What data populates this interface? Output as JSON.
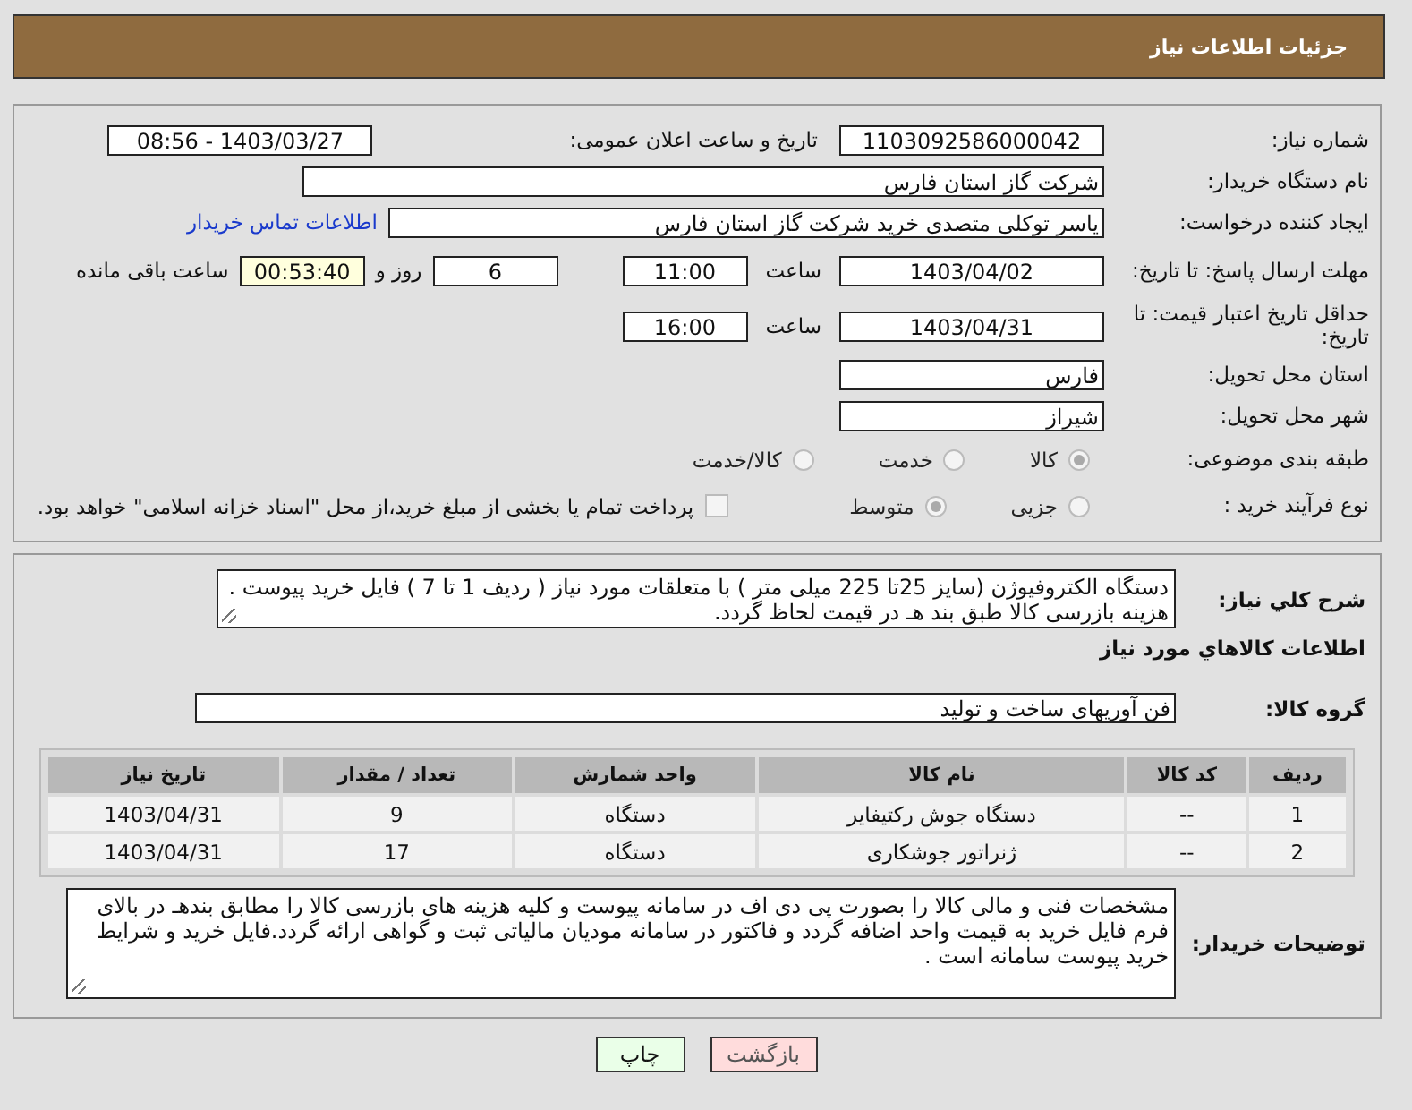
{
  "header": {
    "title": "جزئیات اطلاعات نیاز"
  },
  "details": {
    "need_number": {
      "label": "شماره نیاز:",
      "value": "1103092586000042"
    },
    "announce": {
      "label": "تاریخ و ساعت اعلان عمومی:",
      "value": "1403/03/27 - 08:56"
    },
    "buyer": {
      "label": "نام دستگاه خریدار:",
      "value": "شرکت گاز استان فارس"
    },
    "creator": {
      "label": "ایجاد کننده درخواست:",
      "value": "یاسر توکلی متصدی خرید شرکت گاز استان فارس",
      "link": "اطلاعات تماس خریدار"
    },
    "deadline": {
      "label": "مهلت ارسال پاسخ: تا تاریخ:",
      "date": "1403/04/02",
      "time_label": "ساعت",
      "time": "11:00",
      "days": "6",
      "days_label": "روز و",
      "remaining": "00:53:40",
      "remaining_label": "ساعت باقی مانده"
    },
    "validity": {
      "label": "حداقل تاریخ اعتبار قیمت: تا تاریخ:",
      "date": "1403/04/31",
      "time_label": "ساعت",
      "time": "16:00"
    },
    "province": {
      "label": "استان محل تحویل:",
      "value": "فارس"
    },
    "city": {
      "label": "شهر محل تحویل:",
      "value": "شیراز"
    },
    "category": {
      "label": "طبقه بندی موضوعی:",
      "options": [
        {
          "label": "کالا",
          "selected": true
        },
        {
          "label": "خدمت",
          "selected": false
        },
        {
          "label": "کالا/خدمت",
          "selected": false
        }
      ]
    },
    "process": {
      "label": "نوع فرآیند خرید :",
      "options": [
        {
          "label": "جزیی",
          "selected": false
        },
        {
          "label": "متوسط",
          "selected": true
        }
      ],
      "payment": {
        "checked": false,
        "text": "پرداخت تمام یا بخشی از مبلغ خرید،از محل \"اسناد خزانه اسلامی\" خواهد بود."
      }
    }
  },
  "description": {
    "label": "شرح کلي نياز:",
    "text": "دستگاه الکتروفیوژن (سایز 25تا 225 میلی متر ) با متعلقات مورد نیاز ( ردیف 1 تا 7 ) فایل خرید پیوست .\nهزینه بازرسی کالا طبق بند هـ در قیمت لحاظ گردد."
  },
  "items_title": "اطلاعات کالاهاي مورد نياز",
  "goods_group": {
    "label": "گروه کالا:",
    "value": "فن آوریهای ساخت و تولید"
  },
  "table": {
    "columns": [
      "ردیف",
      "کد کالا",
      "نام کالا",
      "واحد شمارش",
      "تعداد / مقدار",
      "تاریخ نیاز"
    ],
    "rows": [
      [
        "1",
        "--",
        "دستگاه جوش رکتیفایر",
        "دستگاه",
        "9",
        "1403/04/31"
      ],
      [
        "2",
        "--",
        "ژنراتور جوشکاری",
        "دستگاه",
        "17",
        "1403/04/31"
      ]
    ]
  },
  "buyer_notes": {
    "label": "توضیحات خریدار:",
    "text": "مشخصات فنی و مالی کالا را بصورت پی دی اف در سامانه پیوست و کلیه هزینه های بازرسی کالا را مطابق بندهـ در بالای فرم فایل خرید به قیمت واحد اضافه گردد و فاکتور در سامانه مودیان مالیاتی ثبت و گواهی ارائه گردد.فایل خرید و شرایط خرید پیوست سامانه است ."
  },
  "buttons": [
    {
      "kind": "back",
      "label": "بازگشت"
    },
    {
      "kind": "print",
      "label": "چاپ"
    }
  ]
}
